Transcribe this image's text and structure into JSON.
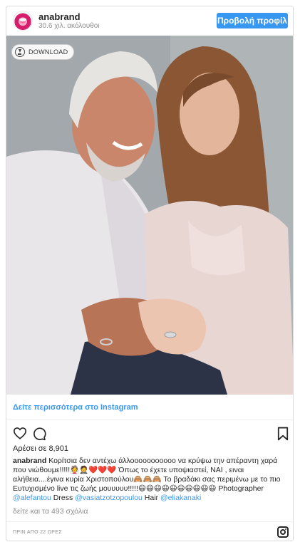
{
  "header": {
    "username": "anabrand",
    "followers": "30.6 χιλ. ακόλουθοι",
    "profile_button": "Προβολή προφίλ"
  },
  "photo": {
    "download_label": "DOWNLOAD",
    "alt": ""
  },
  "view_more": "Δείτε περισσότερα στο Instagram",
  "icons": {
    "like": "heart-icon",
    "comment": "comment-icon",
    "save": "bookmark-icon",
    "instagram": "instagram-icon"
  },
  "likes": "Αρέσει σε 8,901",
  "caption": {
    "user": "anabrand",
    "line1": "Κορίτσια δεν αντέχω άλλοοοοοοοοοοο να κρύψω την απέραντη χαρά που νιώθουμε!!!!!👰🤵❤️❤️❤️ Όπως το έχετε υποψιαστεί, ΝΑΙ , ειναι αλήθεια....έγινα κυρία Χριστοπούλου🙈🙈🙈 Το βραδάκι σας περιμένω με το πιο Ευτυχισμένο live τις ζωής μουυυυυ!!!!!😃😃😃😃😃😃😃😃😃😃 Photographer",
    "mention1": "@alefantou",
    "dress_label": "Dress",
    "mention2": "@vasiatzotzopoulou",
    "hair_label": "Hair",
    "mention3": "@eliakanaki"
  },
  "comments_link": "δείτε και τα 493 σχόλια",
  "timestamp": "ΠΡΙΝ ΑΠΟ 22 ΩΡΕΣ",
  "colors": {
    "accent": "#3897f0",
    "text": "#262626",
    "muted": "#8e8e8e"
  }
}
